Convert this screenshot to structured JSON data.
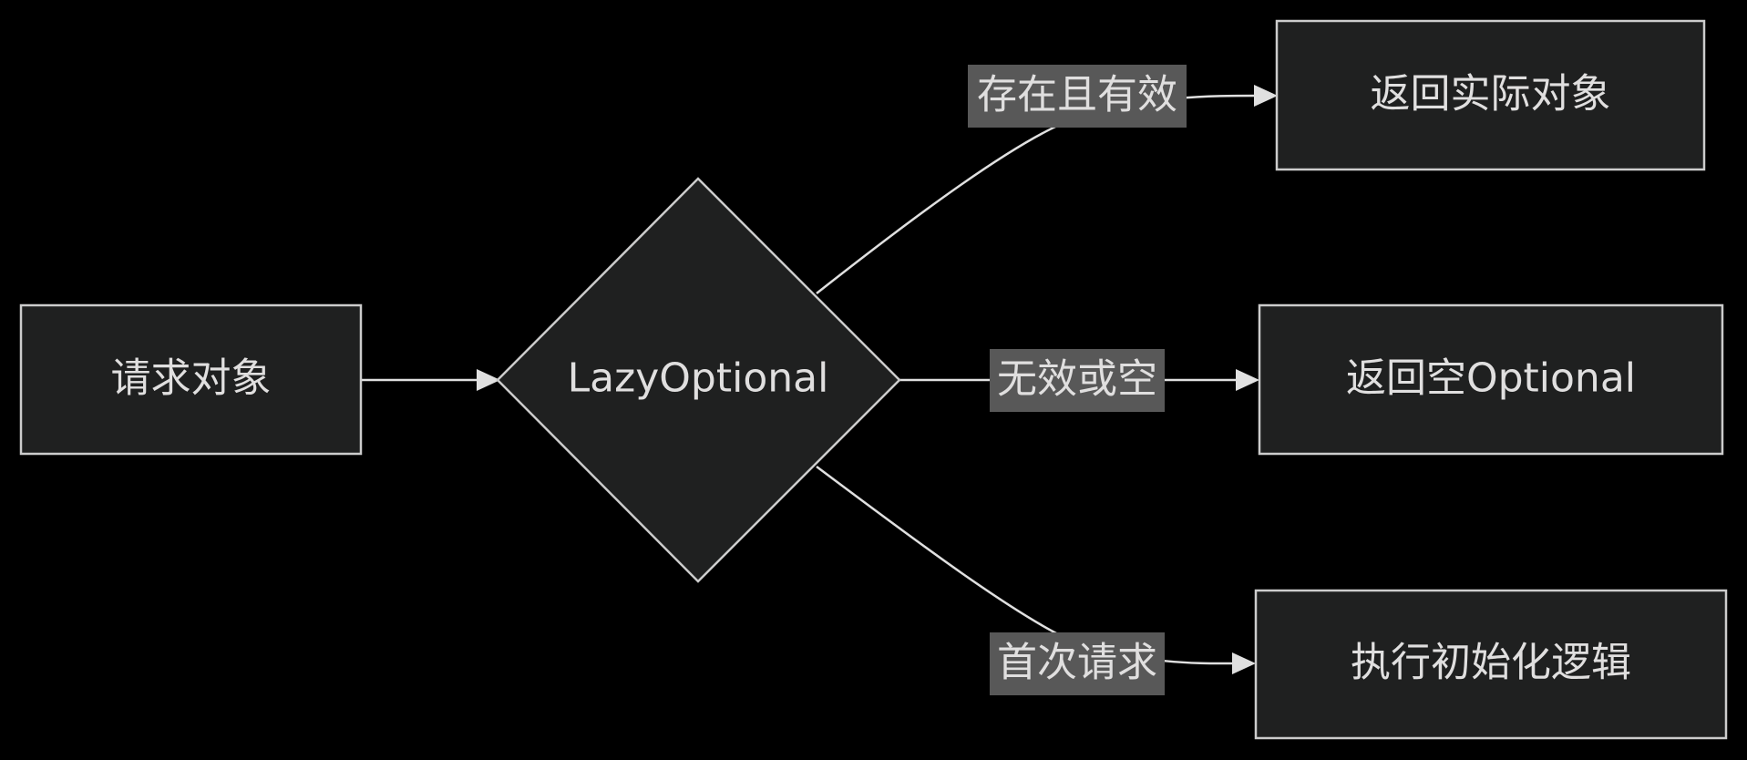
{
  "nodes": {
    "request": {
      "label": "请求对象"
    },
    "decision": {
      "label": "LazyOptional"
    },
    "return_actual": {
      "label": "返回实际对象"
    },
    "return_empty": {
      "label": "返回空Optional"
    },
    "run_init": {
      "label": "执行初始化逻辑"
    }
  },
  "edges": {
    "valid": {
      "label": "存在且有效"
    },
    "invalid": {
      "label": "无效或空"
    },
    "first": {
      "label": "首次请求"
    }
  }
}
